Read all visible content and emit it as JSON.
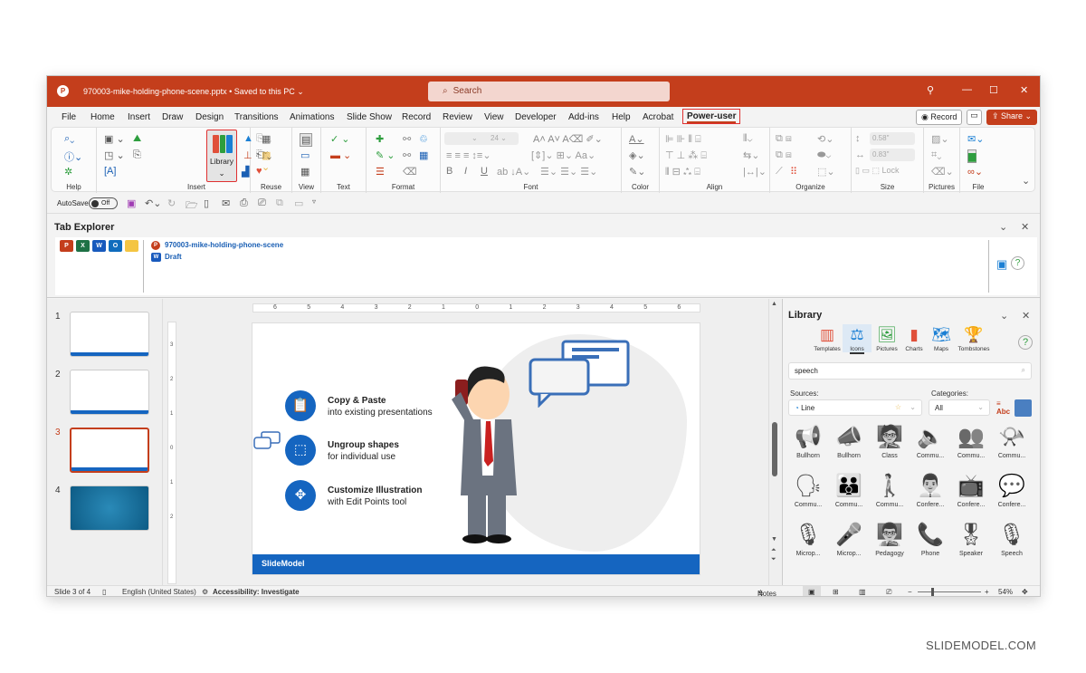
{
  "titlebar": {
    "doc_title": "970003-mike-holding-phone-scene.pptx • Saved to this PC ⌄",
    "search_placeholder": "Search",
    "controls": {
      "location": "⚲",
      "minimize": "—",
      "maximize": "☐",
      "close": "✕"
    }
  },
  "menu": {
    "tabs": [
      "File",
      "Home",
      "Insert",
      "Draw",
      "Design",
      "Transitions",
      "Animations",
      "Slide Show",
      "Record",
      "Review",
      "View",
      "Developer",
      "Add-ins",
      "Help",
      "Acrobat",
      "Power-user"
    ],
    "active_tab": "Power-user",
    "record_label": "◉ Record",
    "comment_icon": "💬",
    "share_label": "⇪ Share ⌄"
  },
  "ribbon": {
    "groups": [
      "Help",
      "Insert",
      "Reuse",
      "View",
      "Text",
      "Format",
      "Font",
      "Color",
      "Align",
      "Organize",
      "Size",
      "Pictures",
      "File"
    ],
    "library_label": "Library",
    "library_chevron": "⌄",
    "font_size": "24",
    "height_value": "0.58\"",
    "width_value": "0.83\"",
    "lock_label": "Lock",
    "collapse_icon": "⌄"
  },
  "qat": {
    "autosave_label": "AutoSave",
    "toggle_label": "Off"
  },
  "tab_explorer": {
    "title": "Tab Explorer",
    "files": [
      {
        "name": "970003-mike-holding-phone-scene",
        "type": "pptx"
      },
      {
        "name": "Draft",
        "type": "docx"
      }
    ]
  },
  "slides": {
    "count": 4,
    "selected": 3,
    "numbers": [
      "1",
      "2",
      "3",
      "4"
    ]
  },
  "ruler": {
    "h_ticks": [
      "6",
      "5",
      "4",
      "3",
      "2",
      "1",
      "0",
      "1",
      "2",
      "3",
      "4",
      "5",
      "6"
    ],
    "v_ticks": [
      "3",
      "2",
      "1",
      "0",
      "1",
      "2"
    ]
  },
  "slide": {
    "bullets": [
      {
        "icon": "📋",
        "title": "Copy & Paste",
        "subtitle": "into existing presentations"
      },
      {
        "icon": "⬚",
        "title": "Ungroup shapes",
        "subtitle": "for individual use"
      },
      {
        "icon": "✥",
        "title": "Customize Illustration",
        "subtitle": "with Edit Points tool"
      }
    ],
    "footer_logo": "SlideModel",
    "accent_color": "#1565c0"
  },
  "library": {
    "title": "Library",
    "tabs": [
      {
        "label": "Templates",
        "glyph": "▥"
      },
      {
        "label": "Icons",
        "glyph": "⚖"
      },
      {
        "label": "Pictures",
        "glyph": "🖼"
      },
      {
        "label": "Charts",
        "glyph": "▮"
      },
      {
        "label": "Maps",
        "glyph": "🗺"
      },
      {
        "label": "Tombstones",
        "glyph": "🏆"
      }
    ],
    "active_tab": "Icons",
    "help_icon": "?",
    "search_value": "speech",
    "sources_label": "Sources:",
    "source_value": "Line",
    "categories_label": "Categories:",
    "category_value": "All",
    "icons": [
      {
        "label": "Bullhorn",
        "glyph": "📢"
      },
      {
        "label": "Bullhorn",
        "glyph": "📣"
      },
      {
        "label": "Class",
        "glyph": "🧑‍🏫"
      },
      {
        "label": "Commu...",
        "glyph": "🔈"
      },
      {
        "label": "Commu...",
        "glyph": "👥"
      },
      {
        "label": "Commu...",
        "glyph": "📯"
      },
      {
        "label": "Commu...",
        "glyph": "🗣"
      },
      {
        "label": "Commu...",
        "glyph": "👪"
      },
      {
        "label": "Commu...",
        "glyph": "🚶"
      },
      {
        "label": "Confere...",
        "glyph": "👨‍💼"
      },
      {
        "label": "Confere...",
        "glyph": "📺"
      },
      {
        "label": "Confere...",
        "glyph": "💬"
      },
      {
        "label": "Microp...",
        "glyph": "🎙"
      },
      {
        "label": "Microp...",
        "glyph": "🎤"
      },
      {
        "label": "Pedagogy",
        "glyph": "👨‍🏫"
      },
      {
        "label": "Phone",
        "glyph": "📞"
      },
      {
        "label": "Speaker",
        "glyph": "🎖"
      },
      {
        "label": "Speech",
        "glyph": "🎙"
      }
    ]
  },
  "statusbar": {
    "slide_info": "Slide 3 of 4",
    "language": "English (United States)",
    "accessibility": "Accessibility: Investigate",
    "notes_label": "Notes",
    "zoom_minus": "−",
    "zoom_plus": "+",
    "zoom_level": "54%"
  },
  "watermark": "SLIDEMODEL.COM"
}
